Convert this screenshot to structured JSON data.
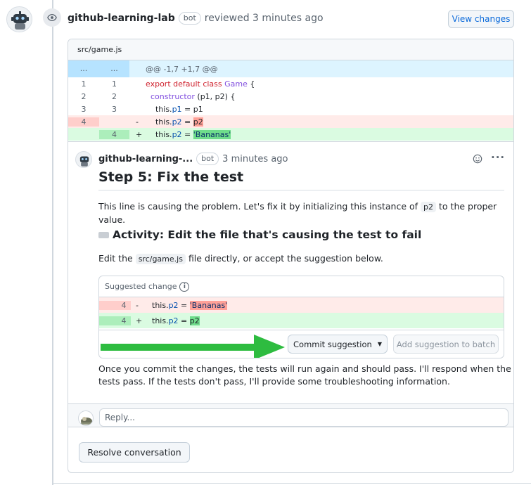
{
  "review": {
    "author": "github-learning-lab",
    "bot_label": "bot",
    "action_text": "reviewed 3 minutes ago",
    "view_changes": "View changes"
  },
  "file": {
    "path": "src/game.js",
    "hunk": {
      "left": "...",
      "right": "...",
      "text": "@@ -1,7 +1,7 @@"
    },
    "lines": [
      {
        "old": "1",
        "new": "1",
        "marker": "",
        "type": "context",
        "code": "export default class Game {"
      },
      {
        "old": "2",
        "new": "2",
        "marker": "",
        "type": "context",
        "code": "  constructor (p1, p2) {"
      },
      {
        "old": "3",
        "new": "3",
        "marker": "",
        "type": "context",
        "code": "    this.p1 = p1"
      },
      {
        "old": "4",
        "new": "",
        "marker": "-",
        "type": "deleted",
        "code": "    this.p2 = p2"
      },
      {
        "old": "",
        "new": "4",
        "marker": "+",
        "type": "added",
        "code": "    this.p2 = 'Bananas'"
      }
    ]
  },
  "comment": {
    "author": "github-learning-...",
    "bot_label": "bot",
    "time": "3 minutes ago",
    "title": "Step 5: Fix the test",
    "intro_before": "This line is causing the problem. Let's fix it by initializing this instance of",
    "intro_code": "p2",
    "intro_after": "to the proper value.",
    "activity_title": "Activity: Edit the file that's causing the test to fail",
    "edit_before": "Edit the",
    "edit_code": "src/game.js",
    "edit_after": "file directly, or accept the suggestion below.",
    "suggestion": {
      "header": "Suggested change",
      "rows": [
        {
          "line": "4",
          "marker": "-",
          "type": "deleted",
          "code": "this.p2 = 'Bananas'"
        },
        {
          "line": "4",
          "marker": "+",
          "type": "added",
          "code": "this.p2 = p2"
        }
      ],
      "commit_button": "Commit suggestion",
      "batch_button": "Add suggestion to batch"
    },
    "closing_line1": "Once you commit the changes, the tests will run again and should pass. I'll respond when the",
    "closing_line2": "tests pass. If the tests don't pass, I'll provide some troubleshooting information."
  },
  "reply": {
    "placeholder": "Reply..."
  },
  "resolve_button": "Resolve conversation",
  "colors": {
    "accent": "#0969da",
    "arrow": "#2ebc40",
    "deleted_bg": "#ffebe9",
    "added_bg": "#dafbe1"
  }
}
